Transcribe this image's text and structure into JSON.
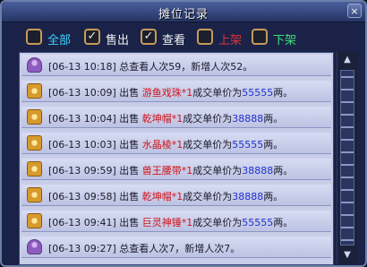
{
  "window": {
    "title": "摊位记录",
    "close_label": "×"
  },
  "filters": [
    {
      "label": "全部",
      "checked": false,
      "color": "#3fd0ff"
    },
    {
      "label": "售出",
      "checked": true,
      "color": "#f0f0f0"
    },
    {
      "label": "查看",
      "checked": true,
      "color": "#f0f0f0"
    },
    {
      "label": "上架",
      "checked": false,
      "color": "#e0303a"
    },
    {
      "label": "下架",
      "checked": false,
      "color": "#3ee07a"
    }
  ],
  "records": [
    {
      "icon": "person-icon",
      "ts": "[06-13 10:18]",
      "parts": [
        {
          "t": "总查看人次59，新增人次52。",
          "c": "t-ts"
        }
      ]
    },
    {
      "icon": "coin-icon",
      "ts": "[06-13 10:09]",
      "parts": [
        {
          "t": "出售 ",
          "c": "t-ts"
        },
        {
          "t": "游鱼戏珠*1",
          "c": "t-item"
        },
        {
          "t": "成交单价为",
          "c": "t-ts"
        },
        {
          "t": "55555",
          "c": "t-num"
        },
        {
          "t": "两。",
          "c": "t-ts"
        }
      ]
    },
    {
      "icon": "coin-icon",
      "ts": "[06-13 10:04]",
      "parts": [
        {
          "t": "出售 ",
          "c": "t-ts"
        },
        {
          "t": "乾坤帽*1",
          "c": "t-item"
        },
        {
          "t": "成交单价为",
          "c": "t-ts"
        },
        {
          "t": "38888",
          "c": "t-num"
        },
        {
          "t": "两。",
          "c": "t-ts"
        }
      ]
    },
    {
      "icon": "coin-icon",
      "ts": "[06-13 10:03]",
      "parts": [
        {
          "t": "出售 ",
          "c": "t-ts"
        },
        {
          "t": "水晶棱*1",
          "c": "t-item"
        },
        {
          "t": "成交单价为",
          "c": "t-ts"
        },
        {
          "t": "55555",
          "c": "t-num"
        },
        {
          "t": "两。",
          "c": "t-ts"
        }
      ]
    },
    {
      "icon": "coin-icon",
      "ts": "[06-13 09:59]",
      "parts": [
        {
          "t": "出售 ",
          "c": "t-ts"
        },
        {
          "t": "兽王腰带*1",
          "c": "t-item"
        },
        {
          "t": "成交单价为",
          "c": "t-ts"
        },
        {
          "t": "38888",
          "c": "t-num"
        },
        {
          "t": "两。",
          "c": "t-ts"
        }
      ]
    },
    {
      "icon": "coin-icon",
      "ts": "[06-13 09:58]",
      "parts": [
        {
          "t": "出售 ",
          "c": "t-ts"
        },
        {
          "t": "乾坤帽*1",
          "c": "t-item"
        },
        {
          "t": "成交单价为",
          "c": "t-ts"
        },
        {
          "t": "38888",
          "c": "t-num"
        },
        {
          "t": "两。",
          "c": "t-ts"
        }
      ]
    },
    {
      "icon": "coin-icon",
      "ts": "[06-13 09:41]",
      "parts": [
        {
          "t": "出售 ",
          "c": "t-ts"
        },
        {
          "t": "巨灵神锤*1",
          "c": "t-item"
        },
        {
          "t": "成交单价为",
          "c": "t-ts"
        },
        {
          "t": "55555",
          "c": "t-num"
        },
        {
          "t": "两。",
          "c": "t-ts"
        }
      ]
    },
    {
      "icon": "person-icon",
      "ts": "[06-13 09:27]",
      "parts": [
        {
          "t": "总查看人次7，新增人次7。",
          "c": "t-ts"
        }
      ]
    }
  ],
  "colors": {
    "accent": "#4a5f9c",
    "item": "#d0141a",
    "price": "#2030d0"
  }
}
